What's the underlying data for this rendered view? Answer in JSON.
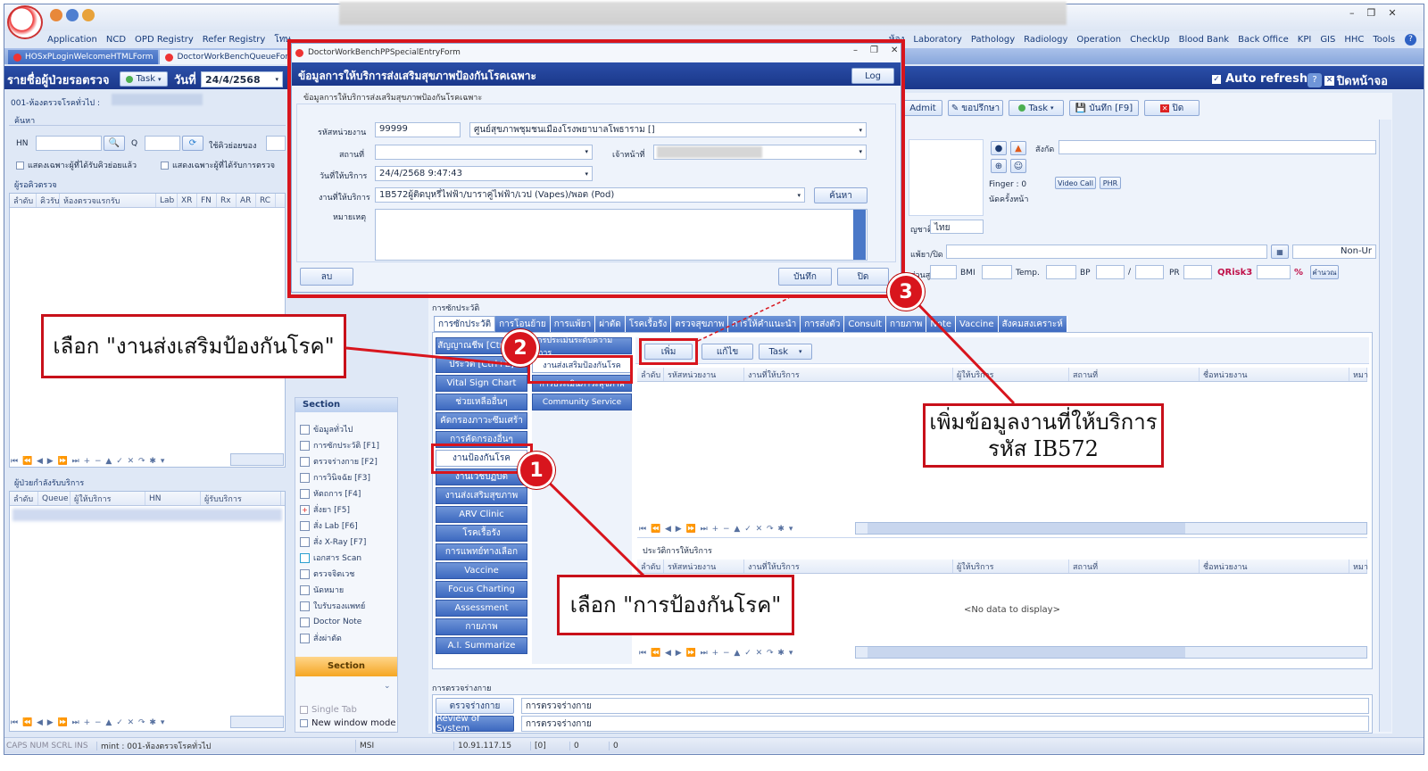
{
  "menubar": {
    "items": [
      "Application",
      "NCD",
      "OPD Registry",
      "Refer Registry",
      "โทษ",
      "ห้อง",
      "Laboratory",
      "Pathology",
      "Radiology",
      "Operation",
      "CheckUp",
      "Blood Bank",
      "Back Office",
      "KPI",
      "GIS",
      "HHC",
      "Tools"
    ],
    "help": "?"
  },
  "doc_tabs": [
    {
      "label": "HOSxPLoginWelcomeHTMLForm"
    },
    {
      "label": "DoctorWorkBenchQueueForm"
    }
  ],
  "header": {
    "title": "รายชื่อผู้ป่วยรอตรวจ",
    "task_label": "Task",
    "date_label": "วันที่",
    "date_value": "24/4/2568",
    "auto_refresh": "Auto refresh",
    "close_screen": "ปิดหน้าจอ"
  },
  "left": {
    "room": "001-ห้องตรวจโรคทั่วไป :",
    "search_label": "ค้นหา",
    "hn_label": "HN",
    "q_label": "Q",
    "use_sub": "ใช้คิวย่อยของ",
    "chk1": "แสดงเฉพาะผู้ที่ได้รับคิวย่อยแล้ว",
    "chk2": "แสดงเฉพาะผู้ที่ได้รับการตรวจ",
    "waiting_label": "ผู้รอคิวตรวจ",
    "wait_cols": [
      "ลำดับ",
      "คิวรับ",
      "ห้องตรวจแรกรับ",
      "Lab",
      "XR",
      "FN",
      "Rx",
      "AR",
      "RC"
    ],
    "serving_label": "ผู้ป่วยกำลังรับบริการ",
    "serve_cols": [
      "ลำดับ",
      "Queue",
      "ผู้ให้บริการ",
      "HN",
      "ผู้รับบริการ"
    ]
  },
  "section": {
    "title": "Section",
    "items": [
      "ข้อมูลทั่วไป",
      "การซักประวัติ [F1]",
      "ตรวจร่างกาย [F2]",
      "การวินิจฉัย [F3]",
      "หัตถการ [F4]",
      "สั่งยา [F5]",
      "สั่ง Lab [F6]",
      "สั่ง X-Ray [F7]",
      "เอกสาร Scan",
      "ตรวจจิตเวช",
      "นัดหมาย",
      "ใบรับรองแพทย์",
      "Doctor Note",
      "สั่งผ่าตัด"
    ],
    "footer": "Section",
    "single_tab": "Single Tab",
    "new_window": "New window mode"
  },
  "right_toolbar": {
    "admit": "Admit",
    "consult": "ขอปรึกษา",
    "task": "Task",
    "save": "บันทึก [F9]",
    "close": "ปิด"
  },
  "patient": {
    "finger": "Finger : 0",
    "next_appt": "นัดครั้งหน้า",
    "video_call": "Video Call",
    "phr": "PHR",
    "belong": "สังกัด",
    "nationality_label": "ญชาติ",
    "nationality": "ไทย",
    "drug_label": "แพ้ยา/ปิด",
    "non_ur": "Non-Ur",
    "height_label": "ส่วนสูง",
    "bmi": "BMI",
    "temp": "Temp.",
    "bp": "BP",
    "slash": "/",
    "pr": "PR",
    "qrisk": "QRisk3",
    "percent": "%",
    "calc": "คำนวณ"
  },
  "history": {
    "group_label": "การซักประวัติ",
    "tabs": [
      "การซักประวัติ",
      "การโอนย้าย",
      "การแพ้ยา",
      "ผ่าตัด",
      "โรคเรื้อรัง",
      "ตรวจสุขภาพ",
      "การให้คำแนะนำ",
      "การส่งตัว",
      "Consult",
      "กายภาพ",
      "Note",
      "Vaccine",
      "สังคมสงเคราะห์"
    ],
    "vtabs": [
      "สัญญาณชีพ [Ctrl+W]",
      "ประวัติ [Ctrl+E]",
      "Vital Sign Chart",
      "ช่วยเหลืออื่นๆ",
      "คัดกรองภาวะซึมเศร้า",
      "การคัดกรองอื่นๆ",
      "งานป้องกันโรค",
      "งานเวชปฏิบัติ",
      "งานส่งเสริมสุขภาพ",
      "ARV Clinic",
      "โรคเรื้อรัง",
      "การแพทย์ทางเลือก",
      "Vaccine",
      "Focus Charting",
      "Assessment",
      "กายภาพ",
      "A.I. Summarize"
    ],
    "subtabs": [
      "การประเมินระดับความพิการ",
      "งานส่งเสริมป้องกันโรค",
      "การประเมินภาวะสุขภาพ",
      "Community Service"
    ],
    "add": "เพิ่ม",
    "edit": "แก้ไข",
    "task": "Task",
    "grid_cols": [
      "ลำดับ",
      "รหัสหน่วยงาน",
      "งานที่ให้บริการ",
      "ผู้ให้บริการ",
      "สถานที่",
      "ชื่อหน่วยงาน",
      "หมา"
    ],
    "hist_label": "ประวัติการให้บริการ",
    "no_data": "<No data to display>"
  },
  "exam": {
    "label": "การตรวจร่างกาย",
    "btn1": "ตรวจร่างกาย",
    "btn2": "Review of System",
    "val1": "การตรวจร่างกาย",
    "val2": "การตรวจร่างกาย"
  },
  "status": {
    "keys": "CAPS  NUM  SCRL  INS",
    "room": "mint : 001-ห้องตรวจโรคทั่วไป",
    "msi": "MSI",
    "ip": "10.91.117.15",
    "c1": "[0]",
    "c2": "0",
    "c3": "0"
  },
  "dialog": {
    "window_title": "DoctorWorkBenchPPSpecialEntryForm",
    "header": "ข้อมูลการให้บริการส่งเสริมสุขภาพป้องกันโรคเฉพาะ",
    "log": "Log",
    "group": "ข้อมูลการให้บริการส่งเสริมสุขภาพป้องกันโรคเฉพาะ",
    "unit_label": "รหัสหน่วยงาน",
    "unit_code": "99999",
    "unit_name": "ศูนย์สุขภาพชุมชนเมืองโรงพยาบาลโพธาราม []",
    "place_label": "สถานที่",
    "staff_label": "เจ้าหน้าที่",
    "date_label": "วันที่ให้บริการ",
    "date_value": "24/4/2568 9:47:43",
    "service_label": "งานที่ให้บริการ",
    "service_value": "1B572ผู้ติดบุหรี่ไฟฟ้า/บาราคู่ไฟฟ้า/เวป (Vapes)/พอต (Pod)",
    "search": "ค้นหา",
    "note_label": "หมายเหตุ",
    "delete": "ลบ",
    "save": "บันทึก",
    "close": "ปิด"
  },
  "annotations": {
    "c1": "เลือก \"การป้องกันโรค\"",
    "c2": "เลือก \"งานส่งเสริมป้องกันโรค\"",
    "c3": "เพิ่มข้อมูลงานที่ให้บริการรหัส IB572",
    "n1": "1",
    "n2": "2",
    "n3": "3"
  },
  "colors": {
    "accent": "#3d69c0",
    "annotation_red": "#d8151d",
    "header_bar": "#1f3f93"
  }
}
